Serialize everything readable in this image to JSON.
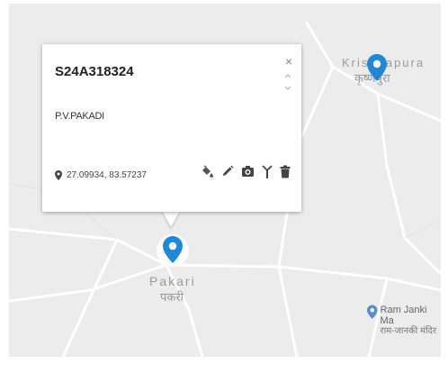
{
  "map": {
    "places": [
      {
        "id": "krishnapura",
        "latin": "Krishnapura",
        "devanagari": "कृष्णपुरा"
      },
      {
        "id": "pakari",
        "latin": "Pakari",
        "devanagari": "पकरी"
      }
    ],
    "poi": {
      "latin": "Ram Janki Ma",
      "devanagari": "राम-जानकी मंदिर"
    }
  },
  "popup": {
    "title": "S24A318324",
    "subtitle": "P.V.PAKADI",
    "coordinates": "27.09934, 83.57237",
    "close_label": "×"
  },
  "colors": {
    "marker": "#1f88d9",
    "map_bg": "#ececec",
    "road": "#ffffff",
    "icon": "#444444"
  },
  "icons": [
    "pin-icon",
    "paint-bucket-icon",
    "pencil-icon",
    "camera-icon",
    "antenna-icon",
    "trash-icon"
  ]
}
